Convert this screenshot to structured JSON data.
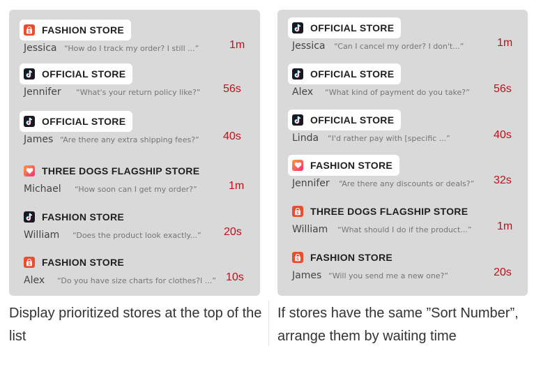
{
  "left_panel": {
    "rows": [
      {
        "store": "FASHION STORE",
        "icon": "shop-bag-icon",
        "highlighted": true,
        "customer": "Jessica",
        "preview": "“How do I track my order? I still ...”",
        "wait": "1m"
      },
      {
        "store": "OFFICIAL STORE",
        "icon": "tiktok-icon",
        "highlighted": true,
        "customer": "Jennifer",
        "preview": "“What's your return policy like?”",
        "wait": "56s"
      },
      {
        "store": "OFFICIAL STORE",
        "icon": "tiktok-icon",
        "highlighted": true,
        "customer": "James",
        "preview": "“Are there any extra shipping fees?”",
        "wait": "40s"
      },
      {
        "store": "THREE DOGS FLAGSHIP STORE",
        "icon": "heart-icon",
        "highlighted": false,
        "customer": "Michael",
        "preview": "“How soon can I get my order?”",
        "wait": "1m"
      },
      {
        "store": "FASHION STORE",
        "icon": "tiktok-icon",
        "highlighted": false,
        "customer": "William",
        "preview": "“Does the product look exactly...”",
        "wait": "20s"
      },
      {
        "store": "FASHION STORE",
        "icon": "shop-bag-icon",
        "highlighted": false,
        "customer": "Alex",
        "preview": "“Do you have size charts for clothes?I ...”",
        "wait": "10s"
      }
    ],
    "caption": "Display prioritized stores at the top of the list"
  },
  "right_panel": {
    "rows": [
      {
        "store": "OFFICIAL STORE",
        "icon": "tiktok-icon",
        "highlighted": true,
        "customer": "Jessica",
        "preview": "“Can I cancel my order? I don't...”",
        "wait": "1m"
      },
      {
        "store": "OFFICIAL STORE",
        "icon": "tiktok-icon",
        "highlighted": true,
        "customer": "Alex",
        "preview": "“What kind of payment do you take?”",
        "wait": "56s"
      },
      {
        "store": "OFFICIAL STORE",
        "icon": "tiktok-icon",
        "highlighted": true,
        "customer": "Linda",
        "preview": "“I'd rather pay with [specific ...”",
        "wait": "40s"
      },
      {
        "store": "FASHION STORE",
        "icon": "heart-icon",
        "highlighted": true,
        "customer": "Jennifer",
        "preview": "“Are there any discounts or deals?”",
        "wait": "32s"
      },
      {
        "store": "THREE DOGS FLAGSHIP STORE",
        "icon": "shop-bag-icon",
        "highlighted": false,
        "customer": "William",
        "preview": "“What should I do if the product...”",
        "wait": "1m"
      },
      {
        "store": "FASHION STORE",
        "icon": "shop-bag-icon",
        "highlighted": false,
        "customer": "James",
        "preview": "“Will you send me a new one?”",
        "wait": "20s"
      }
    ],
    "caption": "If stores have the same ”Sort Number”, arrange them by waiting time"
  },
  "colors": {
    "panel_bg": "#d9d9d9",
    "highlight_bg": "#ffffff",
    "wait_time": "#c0101a",
    "shop_icon": "#ee4d2d",
    "tiktok_icon": "#161823",
    "heart_icon_gradient": "#ff9a3d to #ff2d78"
  }
}
